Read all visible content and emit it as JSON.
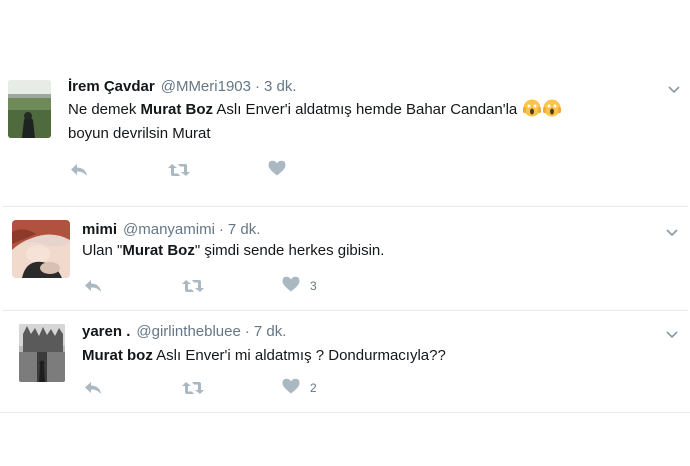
{
  "tweets": [
    {
      "name": "İrem Çavdar",
      "handle": "@MMeri1903",
      "separator": "·",
      "time": "3 dk.",
      "text_parts": [
        "Ne demek ",
        "Murat Boz",
        "  Aslı Enver'i  aldatmış hemde Bahar Candan'la ",
        "boyun devrilsin Murat"
      ],
      "emoji": "screaming-face-icon",
      "like_count": ""
    },
    {
      "name": "mimi",
      "handle": "@manyamimi",
      "separator": "·",
      "time": "7 dk.",
      "text_parts": [
        "Ulan \"",
        "Murat Boz",
        "\" şimdi sende herkes gibisin."
      ],
      "like_count": "3"
    },
    {
      "name": "yaren .",
      "handle": "@girlinthebluee",
      "separator": "·",
      "time": "7 dk.",
      "text_parts": [
        "Murat boz",
        " Aslı Enver'i mi aldatmış ? Dondurmacıyla??"
      ],
      "like_count": "2"
    }
  ],
  "colors": {
    "icon": "#aab8c2",
    "meta": "#657786",
    "border": "#e6ecf0"
  }
}
